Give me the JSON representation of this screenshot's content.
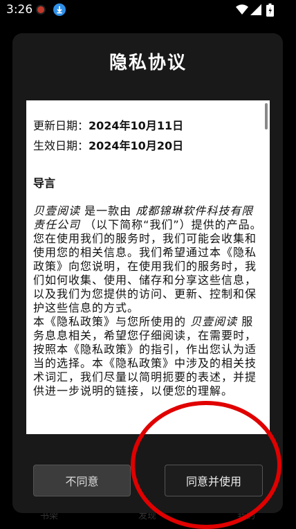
{
  "status_bar": {
    "time": "3:26",
    "icons": [
      "app-notification-icon",
      "download-icon",
      "wifi-icon",
      "signal-icon",
      "battery-icon"
    ]
  },
  "background_tabs": [
    "书架",
    "发现",
    "我的"
  ],
  "dialog": {
    "title": "隐私协议",
    "update_label": "更新日期：",
    "update_date": "2024年10月11日",
    "effective_label": "生效日期：",
    "effective_date": "2024年10月20日",
    "section_title": "导言",
    "p1_app": "贝壹阅读",
    "p1_mid": " 是一款由 ",
    "p1_company": "成都锦琳软件科技有限责任公司",
    "p1_end": " （以下简称“我们”）提供的产品。",
    "p2": "您在使用我们的服务时，我们可能会收集和使用您的相关信息。我们希望通过本《隐私政策》向您说明，在使用我们的服务时，我们如何收集、使用、储存和分享这些信息，以及我们为您提供的访问、更新、控制和保护这些信息的方式。",
    "p3_start": "本《隐私政策》与您所使用的 ",
    "p3_app": "贝壹阅读",
    "p3_end": " 服务息息相关，希望您仔细阅读，在需要时，按照本《隐私政策》的指引，作出您认为适当的选择。本《隐私政策》中涉及的相关技术词汇，我们尽量以简明扼要的表述，并提供进一步说明的链接，以便您的理解。",
    "disagree_label": "不同意",
    "agree_label": "同意并使用"
  },
  "colors": {
    "annotation": "#e00000",
    "dialog_bg": "#191919",
    "download_icon": "#2f8fe8"
  }
}
